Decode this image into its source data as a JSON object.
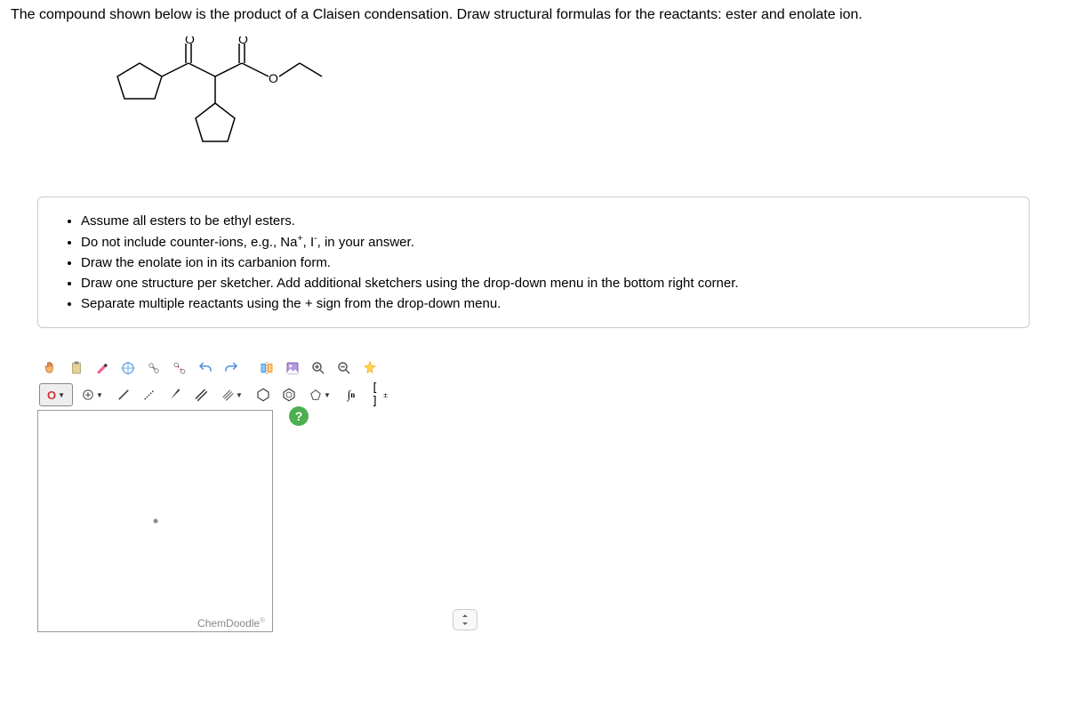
{
  "question": "The compound shown below is the product of a Claisen condensation. Draw structural formulas for the reactants: ester and enolate ion.",
  "instructions": [
    "Assume all esters to be ethyl esters.",
    "Do not include counter-ions, e.g., Na⁺, I⁻, in your answer.",
    "Draw the enolate ion in its carbanion form.",
    "Draw one structure per sketcher. Add additional sketchers using the drop-down menu in the bottom right corner.",
    "Separate multiple reactants using the + sign from the drop-down menu."
  ],
  "toolbar": {
    "row1": {
      "hand": "✋",
      "paste": "📋",
      "marker": "🖍",
      "center": "⊕",
      "link1": "🔗",
      "link2": "🔗",
      "undo": "↶",
      "redo": "↷",
      "flip": "↔",
      "search": "🔍",
      "zoomin": "🔍+",
      "zoomout": "🔍-",
      "clean": "✨"
    },
    "row2": {
      "element": "O",
      "charge": "⊕",
      "bond1": "/",
      "bond2": "⋰",
      "bond3": "/",
      "bond4": "//",
      "bond5": "///",
      "ring1": "⬡",
      "ring2": "⬡",
      "ring3": "⬠",
      "integral": "∫n",
      "bracket": "[ ]±"
    }
  },
  "sketcher": {
    "brand": "ChemDoodle",
    "help": "?",
    "expand": "⇅"
  }
}
